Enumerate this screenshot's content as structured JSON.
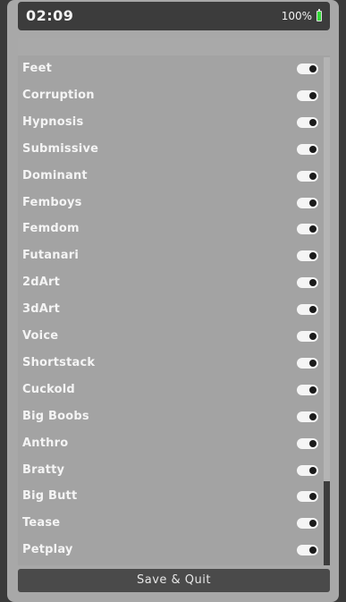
{
  "statusbar": {
    "time": "02:09",
    "battery_text": "100%",
    "battery_color": "#35d93a"
  },
  "settings": {
    "items": [
      {
        "label": "Feet",
        "enabled": true
      },
      {
        "label": "Corruption",
        "enabled": true
      },
      {
        "label": "Hypnosis",
        "enabled": true
      },
      {
        "label": "Submissive",
        "enabled": true
      },
      {
        "label": "Dominant",
        "enabled": true
      },
      {
        "label": "Femboys",
        "enabled": true
      },
      {
        "label": "Femdom",
        "enabled": true
      },
      {
        "label": "Futanari",
        "enabled": true
      },
      {
        "label": "2dArt",
        "enabled": true
      },
      {
        "label": "3dArt",
        "enabled": true
      },
      {
        "label": "Voice",
        "enabled": true
      },
      {
        "label": "Shortstack",
        "enabled": true
      },
      {
        "label": "Cuckold",
        "enabled": true
      },
      {
        "label": "Big Boobs",
        "enabled": true
      },
      {
        "label": "Anthro",
        "enabled": true
      },
      {
        "label": "Bratty",
        "enabled": true
      },
      {
        "label": "Big Butt",
        "enabled": true
      },
      {
        "label": "Tease",
        "enabled": true
      },
      {
        "label": "Petplay",
        "enabled": true
      }
    ]
  },
  "footer": {
    "save_label": "Save & Quit"
  }
}
